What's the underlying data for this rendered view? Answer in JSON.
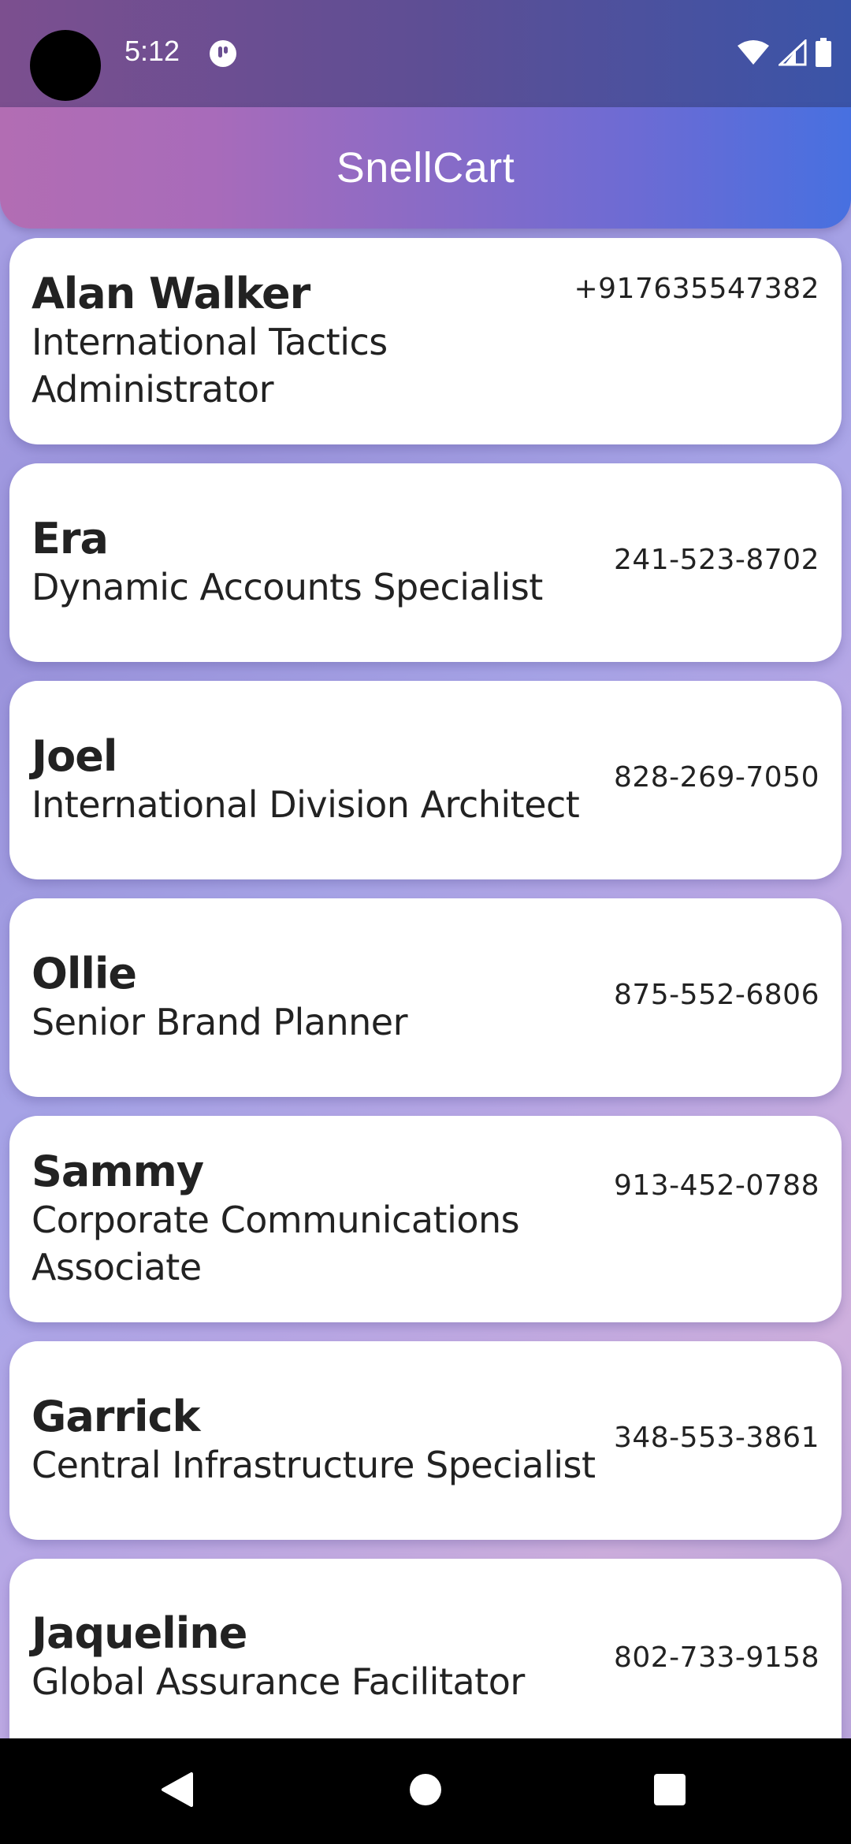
{
  "status_bar": {
    "time": "5:12",
    "icons": [
      "app-notification-icon",
      "wifi-icon",
      "signal-icon",
      "battery-icon"
    ]
  },
  "app_bar": {
    "title": "SnellCart"
  },
  "contacts": [
    {
      "name": "Alan Walker",
      "role": "International Tactics Administrator",
      "phone": "+917635547382"
    },
    {
      "name": "Era",
      "role": "Dynamic Accounts Specialist",
      "phone": "241-523-8702"
    },
    {
      "name": "Joel",
      "role": "International Division Architect",
      "phone": "828-269-7050"
    },
    {
      "name": "Ollie",
      "role": "Senior Brand Planner",
      "phone": "875-552-6806"
    },
    {
      "name": "Sammy",
      "role": "Corporate Communications Associate",
      "phone": "913-452-0788"
    },
    {
      "name": "Garrick",
      "role": "Central Infrastructure Specialist",
      "phone": "348-553-3861"
    },
    {
      "name": "Jaqueline",
      "role": "Global Assurance Facilitator",
      "phone": "802-733-9158"
    }
  ],
  "nav_bar": {
    "icons": [
      "back-icon",
      "home-icon",
      "recents-icon"
    ]
  },
  "colors": {
    "app_bar_start": "#b26db3",
    "app_bar_end": "#4770e0",
    "card_background": "#ffffff",
    "text": "#222222"
  }
}
